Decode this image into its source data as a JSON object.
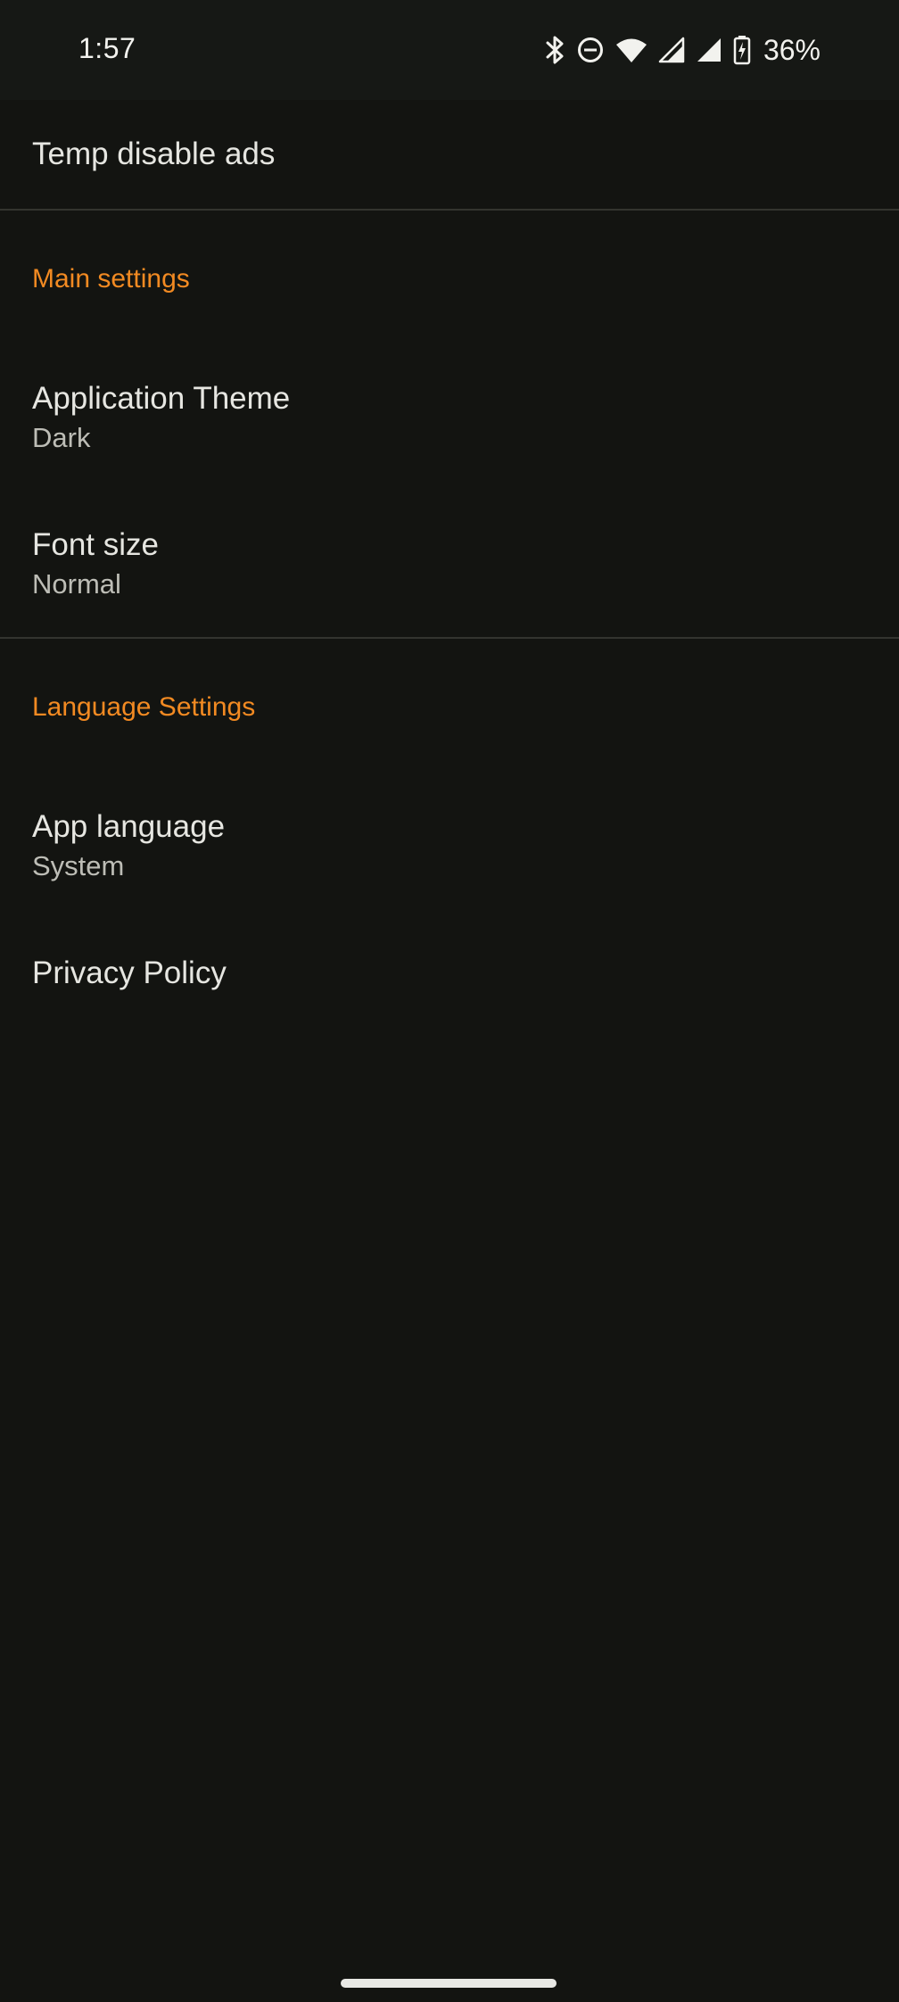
{
  "status_bar": {
    "time": "1:57",
    "battery_percent": "36%",
    "icons": [
      "bluetooth-icon",
      "do-not-disturb-icon",
      "wifi-icon",
      "cell-signal-icon",
      "cell-signal-icon",
      "battery-charging-icon"
    ]
  },
  "settings": {
    "temp_disable_ads": "Temp disable ads",
    "main_section": {
      "header": "Main settings",
      "theme": {
        "title": "Application Theme",
        "summary": "Dark"
      },
      "font_size": {
        "title": "Font size",
        "summary": "Normal"
      }
    },
    "language_section": {
      "header": "Language Settings",
      "app_language": {
        "title": "App language",
        "summary": "System"
      },
      "privacy": {
        "title": "Privacy Policy"
      }
    }
  },
  "colors": {
    "background": "#131411",
    "accent": "#f28a22",
    "title_text": "#e6e6e1",
    "summary_text": "#bdbdb6",
    "divider": "#33342f"
  }
}
